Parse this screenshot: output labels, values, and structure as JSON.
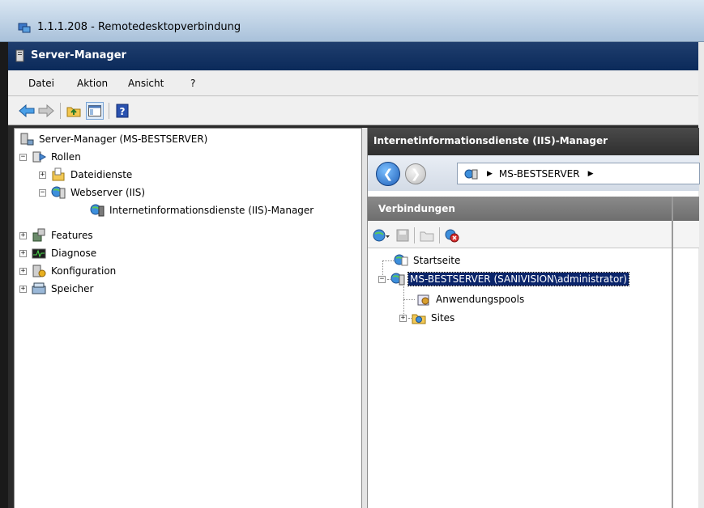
{
  "rdp": {
    "title": "1.1.1.208 - Remotedesktopverbindung"
  },
  "window": {
    "title": "Server-Manager"
  },
  "menu": {
    "items": [
      "Datei",
      "Aktion",
      "Ansicht",
      "?"
    ]
  },
  "left_tree": {
    "root": "Server-Manager (MS-BESTSERVER)",
    "rollen": "Rollen",
    "dateidienste": "Dateidienste",
    "webserver": "Webserver (IIS)",
    "iis_manager": "Internetinformationsdienste (IIS)-Manager",
    "features": "Features",
    "diagnose": "Diagnose",
    "konfiguration": "Konfiguration",
    "speicher": "Speicher"
  },
  "iis": {
    "header": "Internetinformationsdienste (IIS)-Manager",
    "address_segment": "MS-BESTSERVER",
    "connections_header": "Verbindungen",
    "tree": {
      "startseite": "Startseite",
      "server": "MS-BESTSERVER (SANIVISION\\administrator)",
      "apppools": "Anwendungspools",
      "sites": "Sites"
    }
  },
  "expanders": {
    "expanded": "−",
    "collapsed": "+"
  },
  "colors": {
    "title_blue": "#0b2a5a",
    "selection": "#0a246a",
    "iis_header": "#2f2f2f"
  }
}
